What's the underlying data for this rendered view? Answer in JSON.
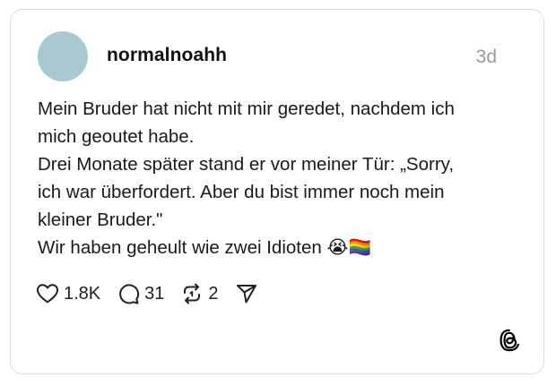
{
  "post": {
    "author": "normalnoahh",
    "timestamp": "3d",
    "avatar_color": "#a9c9d1",
    "lines": [
      "Mein Bruder hat nicht mit mir geredet, nachdem ich",
      "mich geoutet habe.",
      "Drei Monate später stand er vor meiner Tür: „Sorry,",
      "ich war überfordert. Aber du bist immer noch mein",
      "kleiner Bruder.\"",
      "Wir haben geheult wie zwei Idioten 😭🏳️‍🌈"
    ]
  },
  "actions": {
    "likes": "1.8K",
    "replies": "31",
    "reposts": "2"
  },
  "icons": [
    "heart-icon",
    "comment-icon",
    "repost-icon",
    "share-icon",
    "threads-logo-icon"
  ]
}
